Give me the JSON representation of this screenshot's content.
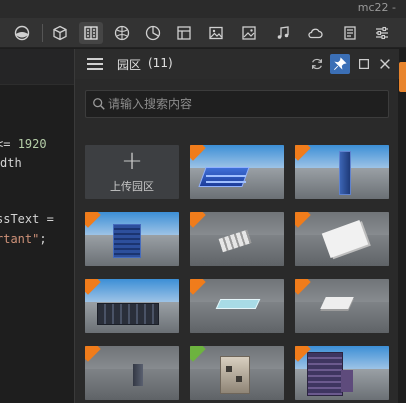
{
  "window": {
    "title": "mc22 -"
  },
  "toolbar": {
    "tools": [
      {
        "name": "terrain-icon"
      },
      {
        "name": "cube-icon"
      },
      {
        "name": "building-icon",
        "active": true
      },
      {
        "name": "globe-icon"
      },
      {
        "name": "pie-chart-icon"
      },
      {
        "name": "layout-icon"
      },
      {
        "name": "image-icon"
      },
      {
        "name": "picture-icon"
      },
      {
        "name": "music-icon"
      },
      {
        "name": "cloud-icon"
      },
      {
        "name": "document-icon"
      },
      {
        "name": "sliders-icon"
      }
    ]
  },
  "editor": {
    "lines": [
      {
        "parts": [
          {
            "text": "<= ",
            "kind": "plain"
          },
          {
            "text": "1920",
            "kind": "num"
          }
        ]
      },
      {
        "parts": [
          {
            "text": "dth",
            "kind": "plain"
          }
        ]
      },
      {
        "parts": [
          {
            "text": "ssText =",
            "kind": "plain"
          }
        ]
      },
      {
        "parts": [
          {
            "text": "rtant\"",
            "kind": "str"
          },
          {
            "text": ";",
            "kind": "plain"
          }
        ]
      }
    ]
  },
  "panel": {
    "title": "园区",
    "count": "(11)",
    "search_placeholder": "请输入搜索内容",
    "upload_label": "上传园区",
    "header_buttons": [
      "refresh-icon",
      "pin-icon",
      "maximize-icon",
      "close-icon"
    ],
    "tiles": [
      {
        "name": "park-tile-1",
        "tag": "orange",
        "scene": "sky",
        "model": "tower-block"
      },
      {
        "name": "park-tile-2",
        "tag": "orange",
        "scene": "sky",
        "model": "tall-tower"
      },
      {
        "name": "park-tile-3",
        "tag": "orange",
        "scene": "sky",
        "model": "blue-slab"
      },
      {
        "name": "park-tile-4",
        "tag": "orange",
        "scene": "gray",
        "model": "white-grid"
      },
      {
        "name": "park-tile-5",
        "tag": "orange",
        "scene": "gray",
        "model": "white-box"
      },
      {
        "name": "park-tile-6",
        "tag": "orange",
        "scene": "sky",
        "model": "dark-campus"
      },
      {
        "name": "park-tile-7",
        "tag": "orange",
        "scene": "gray",
        "model": "glass-pad"
      },
      {
        "name": "park-tile-8",
        "tag": "orange",
        "scene": "gray",
        "model": "white-flat"
      },
      {
        "name": "park-tile-9",
        "tag": "orange",
        "scene": "gray",
        "model": "small-block"
      },
      {
        "name": "park-tile-10",
        "tag": "green",
        "scene": "gray",
        "model": "stone-house"
      },
      {
        "name": "park-tile-11",
        "tag": "orange",
        "scene": "sky",
        "model": "city-cluster"
      }
    ]
  },
  "colors": {
    "accent_orange": "#f07c1b",
    "tag_green": "#6db33f",
    "pin_blue": "#3b6fb6"
  }
}
